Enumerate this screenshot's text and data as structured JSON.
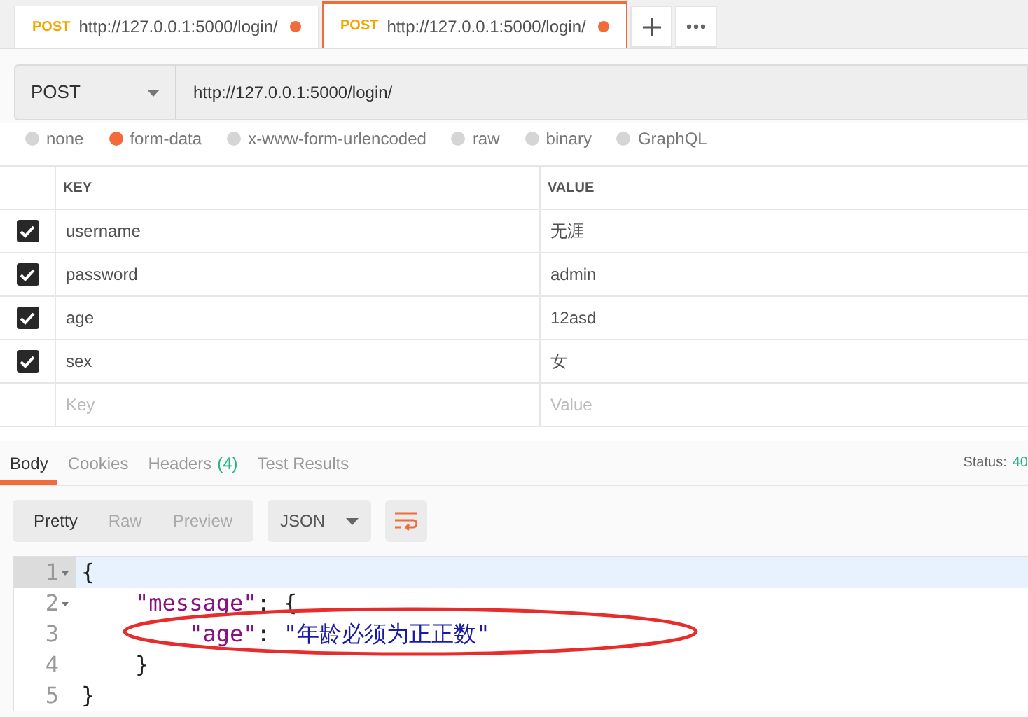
{
  "tabs": [
    {
      "method": "POST",
      "url": "http://127.0.0.1:5000/login/",
      "unsaved": true,
      "selected": false
    },
    {
      "method": "POST",
      "url": "http://127.0.0.1:5000/login/",
      "unsaved": true,
      "selected": true
    }
  ],
  "request": {
    "method": "POST",
    "url": "http://127.0.0.1:5000/login/"
  },
  "body_types": [
    {
      "label": "none",
      "selected": false
    },
    {
      "label": "form-data",
      "selected": true
    },
    {
      "label": "x-www-form-urlencoded",
      "selected": false
    },
    {
      "label": "raw",
      "selected": false
    },
    {
      "label": "binary",
      "selected": false
    },
    {
      "label": "GraphQL",
      "selected": false
    }
  ],
  "params": {
    "columns": [
      "KEY",
      "VALUE"
    ],
    "rows": [
      {
        "key": "username",
        "value": "无涯",
        "checked": true
      },
      {
        "key": "password",
        "value": "admin",
        "checked": true
      },
      {
        "key": "age",
        "value": "12asd",
        "checked": true
      },
      {
        "key": "sex",
        "value": "女",
        "checked": true
      }
    ],
    "new_row": {
      "key": {
        "placeholder": "Key"
      },
      "value": {
        "placeholder": "Value"
      }
    }
  },
  "response": {
    "tabs": [
      {
        "label": "Body",
        "selected": true
      },
      {
        "label": "Cookies",
        "selected": false
      },
      {
        "label": "Headers",
        "count": "(4)",
        "selected": false
      },
      {
        "label": "Test Results",
        "selected": false
      }
    ],
    "status_label": "Status:",
    "status_value": "40",
    "views": [
      {
        "label": "Pretty",
        "selected": true
      },
      {
        "label": "Raw",
        "selected": false
      },
      {
        "label": "Preview",
        "selected": false
      }
    ],
    "format": "JSON",
    "code": [
      {
        "number": "1",
        "foldable": true,
        "active": true,
        "tokens": [
          {
            "kind": "punct",
            "text": "{"
          }
        ]
      },
      {
        "number": "2",
        "foldable": true,
        "active": false,
        "tokens": [
          {
            "kind": "key",
            "text": "    \"message\""
          },
          {
            "kind": "punct",
            "text": ": {"
          }
        ]
      },
      {
        "number": "3",
        "foldable": false,
        "active": false,
        "tokens": [
          {
            "kind": "key",
            "text": "        \"age\""
          },
          {
            "kind": "punct",
            "text": ": "
          },
          {
            "kind": "string",
            "text": "\"年龄必须为正正数\""
          }
        ]
      },
      {
        "number": "4",
        "foldable": false,
        "active": false,
        "tokens": [
          {
            "kind": "punct",
            "text": "    }"
          }
        ]
      },
      {
        "number": "5",
        "foldable": false,
        "active": false,
        "tokens": [
          {
            "kind": "punct",
            "text": "}"
          }
        ]
      }
    ]
  }
}
